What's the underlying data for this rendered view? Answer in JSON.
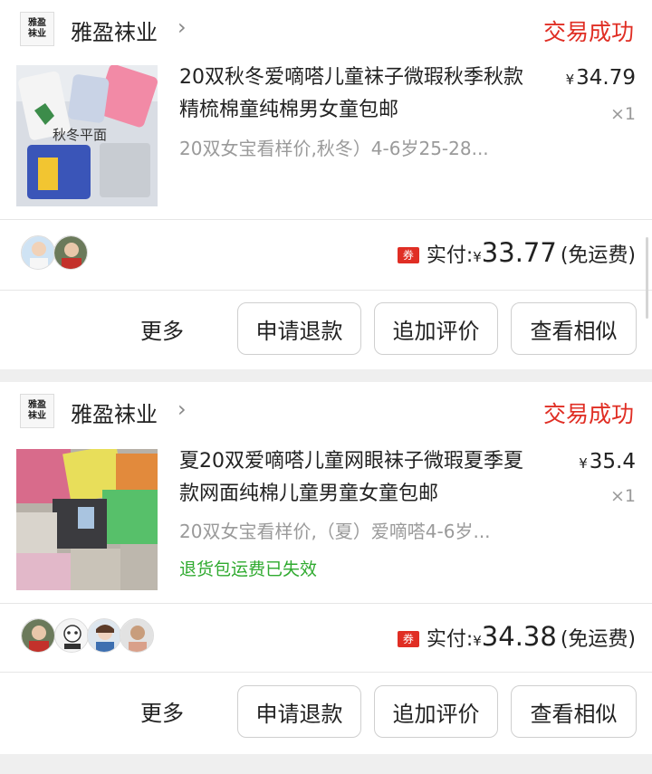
{
  "orders": [
    {
      "shop": {
        "name": "雅盈袜业",
        "logo_text": [
          "雅盈",
          "袜业"
        ]
      },
      "status": "交易成功",
      "product": {
        "title": "20双秋冬爱嘀嗒儿童袜子微瑕秋季秋款精梳棉童纯棉男女童包邮",
        "sku": "20双女宝看样价,秋冬）4-6岁25-28...",
        "thumb_caption": "秋冬平面",
        "price_symbol": "¥",
        "price": "34.79",
        "quantity": "×1"
      },
      "payment": {
        "coupon": "券",
        "label": "实付:",
        "symbol": "¥",
        "amount": "33.77",
        "shipping": "(免运费)"
      },
      "actions": {
        "more": "更多",
        "refund": "申请退款",
        "add_review": "追加评价",
        "similar": "查看相似"
      }
    },
    {
      "shop": {
        "name": "雅盈袜业",
        "logo_text": [
          "雅盈",
          "袜业"
        ]
      },
      "status": "交易成功",
      "product": {
        "title": "夏20双爱嘀嗒儿童网眼袜子微瑕夏季夏款网面纯棉儿童男童女童包邮",
        "sku": "20双女宝看样价,（夏）爱嘀嗒4-6岁...",
        "notice": "退货包运费已失效",
        "price_symbol": "¥",
        "price": "35.4",
        "quantity": "×1"
      },
      "payment": {
        "coupon": "券",
        "label": "实付:",
        "symbol": "¥",
        "amount": "34.38",
        "shipping": "(免运费)"
      },
      "actions": {
        "more": "更多",
        "refund": "申请退款",
        "add_review": "追加评价",
        "similar": "查看相似"
      }
    }
  ],
  "colors": {
    "status": "#e02e24",
    "notice": "#2faa2f",
    "coupon": "#e02e24"
  }
}
